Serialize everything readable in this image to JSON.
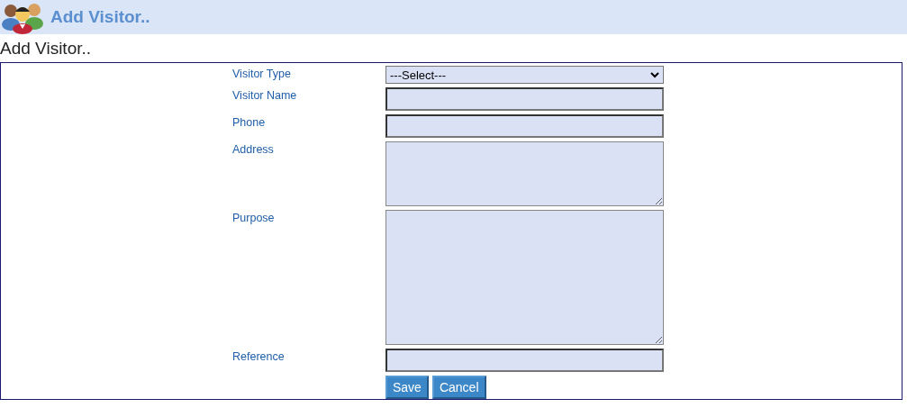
{
  "header": {
    "title": "Add Visitor.."
  },
  "page_title": "Add Visitor..",
  "fields": [
    {
      "label": "Visitor Type",
      "kind": "select",
      "value": "---Select---"
    },
    {
      "label": "Visitor Name",
      "kind": "text"
    },
    {
      "label": "Phone",
      "kind": "text"
    },
    {
      "label": "Address",
      "kind": "textarea"
    },
    {
      "label": "Purpose",
      "kind": "large_textarea"
    },
    {
      "label": "Reference",
      "kind": "text"
    }
  ],
  "buttons": [
    "Save",
    "Cancel"
  ]
}
